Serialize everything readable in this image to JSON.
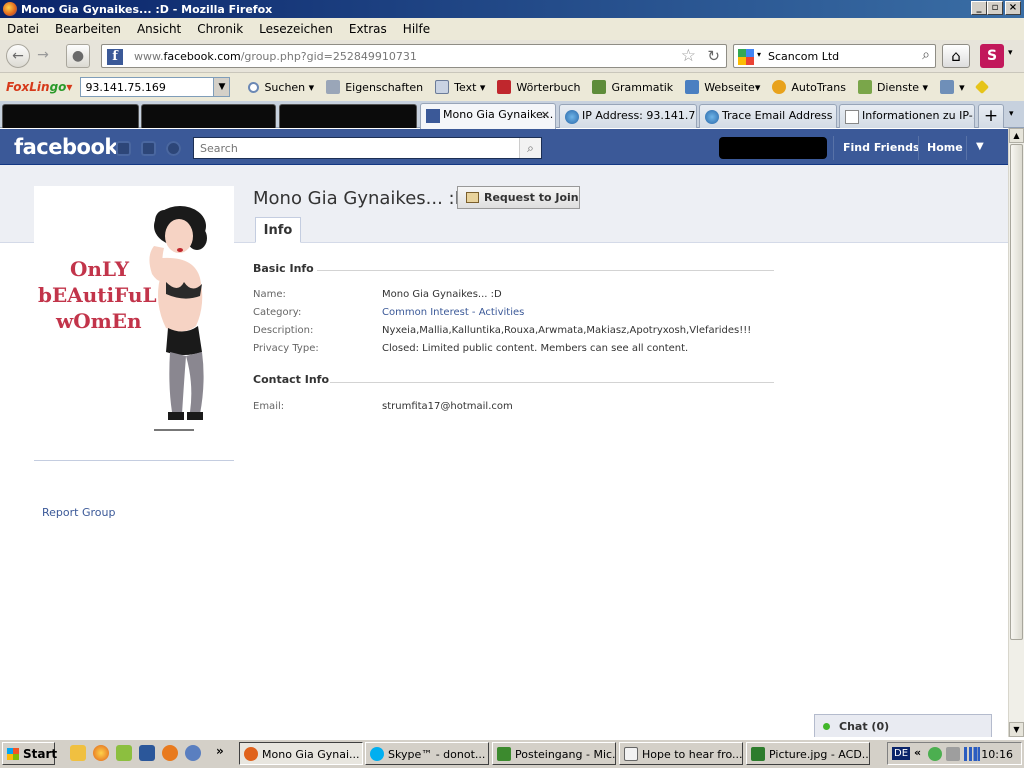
{
  "window": {
    "title": "Mono Gia Gynaikes... :D - Mozilla Firefox",
    "controls": [
      "_",
      "▫",
      "×"
    ]
  },
  "menu": [
    "Datei",
    "Bearbeiten",
    "Ansicht",
    "Chronik",
    "Lesezeichen",
    "Extras",
    "Hilfe"
  ],
  "nav": {
    "url_grey": "www.",
    "url_host": "facebook.com",
    "url_path": "/group.php?gid=252849910731",
    "search_value": "Scancom Ltd"
  },
  "foxlingo": {
    "brand_a": "FoxLin",
    "brand_b": "go",
    "ip_value": "93.141.75.169",
    "tools": [
      "Suchen",
      "Eigenschaften",
      "Text",
      "Wörterbuch",
      "Grammatik",
      "Webseite",
      "AutoTrans",
      "Dienste"
    ]
  },
  "tabs": [
    {
      "label": "",
      "redacted": true
    },
    {
      "label": "",
      "redacted": true
    },
    {
      "label": "",
      "redacted": true
    },
    {
      "label": "Mono Gia Gynaike...",
      "active": true
    },
    {
      "label": "IP Address: 93.141.7..."
    },
    {
      "label": "Trace Email Address ..."
    },
    {
      "label": "Informationen zu IP-..."
    }
  ],
  "fb": {
    "logo": "facebook",
    "search_placeholder": "Search",
    "find_friends": "Find Friends",
    "home": "Home"
  },
  "group": {
    "name": "Mono Gia Gynaikes... :D",
    "join_button": "Request to Join",
    "info_tab": "Info",
    "picture_text": [
      "OnLY",
      "bEAutiFuL",
      "wOmEn"
    ],
    "basic_info_heading": "Basic Info",
    "basic_info": [
      {
        "label": "Name:",
        "value": "Mono Gia Gynaikes... :D"
      },
      {
        "label": "Category:",
        "value": "Common Interest - Activities"
      },
      {
        "label": "Description:",
        "value": "Nyxeia,Mallia,Kalluntika,Rouxa,Arwmata,Makiasz,Apotryxosh,Vlefarides!!!"
      },
      {
        "label": "Privacy Type:",
        "value": "Closed: Limited public content. Members can see all content."
      }
    ],
    "contact_info_heading": "Contact Info",
    "contact_info": [
      {
        "label": "Email:",
        "value": "strumfita17@hotmail.com"
      }
    ],
    "report": "Report Group"
  },
  "chat": {
    "label": "Chat (0)"
  },
  "taskbar": {
    "start": "Start",
    "overflow": "»",
    "tasks": [
      {
        "label": "Mono Gia Gynai...",
        "active": true,
        "color": "#e0621b"
      },
      {
        "label": "Skype™ - donot...",
        "color": "#00aff0"
      },
      {
        "label": "Posteingang - Mic...",
        "color": "#3c8a2e"
      },
      {
        "label": "Hope to hear fro...",
        "color": "#f2f2f2"
      },
      {
        "label": "Picture.jpg - ACD...",
        "color": "#2d7c2d"
      }
    ],
    "tray_lang": "DE",
    "tray_chevron": "«",
    "clock": "10:16"
  },
  "colors": {
    "fb_blue": "#3b5998",
    "link": "#3b5998"
  }
}
